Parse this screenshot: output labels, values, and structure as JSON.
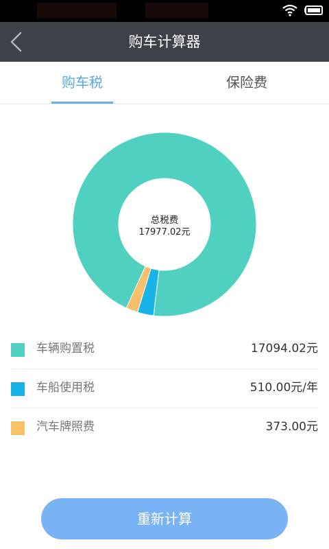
{
  "header": {
    "title": "购车计算器"
  },
  "tabs": [
    {
      "label": "购车税",
      "active": true
    },
    {
      "label": "保险费",
      "active": false
    }
  ],
  "chart_data": {
    "type": "pie",
    "center_label": "总税费",
    "center_value": "17977.02元",
    "slices": [
      {
        "label": "车辆购置税",
        "value": 17094.02,
        "color": "#4fd0c0"
      },
      {
        "label": "车船使用税",
        "value": 510.0,
        "color": "#18b4e8"
      },
      {
        "label": "汽车牌照费",
        "value": 373.0,
        "color": "#f8c06a"
      }
    ]
  },
  "legend": [
    {
      "label": "车辆购置税",
      "value": "17094.02元",
      "color": "#4fd0c0"
    },
    {
      "label": "车船使用税",
      "value": "510.00元/年",
      "color": "#18b4e8"
    },
    {
      "label": "汽车牌照费",
      "value": "373.00元",
      "color": "#f8c06a"
    }
  ],
  "actions": {
    "recalc_label": "重新计算"
  },
  "colors": {
    "title_bar": "#3d4148",
    "accent": "#58a8e8",
    "button": "#7ab3f5"
  }
}
